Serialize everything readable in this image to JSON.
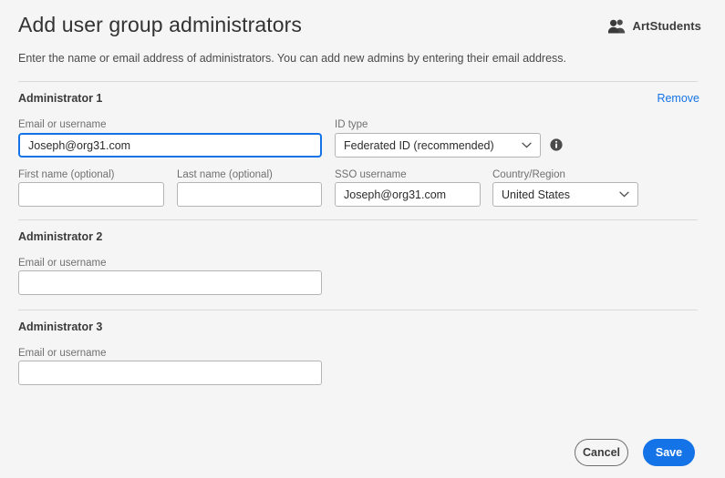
{
  "header": {
    "title": "Add user group administrators",
    "subtitle": "Enter the name or email address of administrators. You can add new admins by entering their email address.",
    "brand_name": "ArtStudents",
    "brand_icon": "people-icon"
  },
  "labels": {
    "email_or_username": "Email or username",
    "id_type": "ID type",
    "first_name": "First name (optional)",
    "last_name": "Last name (optional)",
    "sso_username": "SSO username",
    "country_region": "Country/Region"
  },
  "icons": {
    "info": "info-icon",
    "chevron_down": "chevron-down-icon"
  },
  "administrators": [
    {
      "section_title": "Administrator 1",
      "remove_label": "Remove",
      "email": "Joseph@org31.com",
      "email_placeholder": "",
      "id_type_value": "Federated ID (recommended)",
      "first_name": "",
      "first_name_placeholder": "",
      "last_name": "",
      "last_name_placeholder": "",
      "sso_username": "Joseph@org31.com",
      "country_region_value": "United States"
    },
    {
      "section_title": "Administrator 2",
      "email": "",
      "email_placeholder": ""
    },
    {
      "section_title": "Administrator 3",
      "email": "",
      "email_placeholder": ""
    }
  ],
  "footer": {
    "cancel_label": "Cancel",
    "save_label": "Save"
  },
  "colors": {
    "accent": "#1473e6",
    "link": "#1473e6",
    "page_bg": "#f5f5f5",
    "field_border": "#b4b4b4",
    "divider": "#dadada"
  }
}
